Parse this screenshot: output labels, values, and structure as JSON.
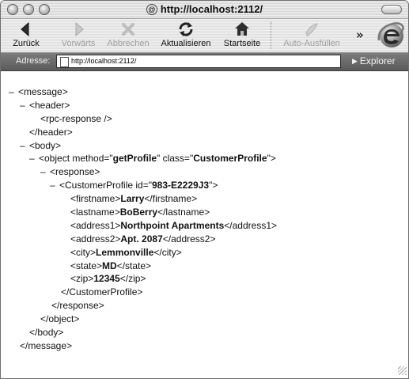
{
  "window": {
    "title": "http://localhost:2112/"
  },
  "toolbar": {
    "back_label": "Zurück",
    "forward_label": "Vorwärts",
    "stop_label": "Abbrechen",
    "refresh_label": "Aktualisieren",
    "home_label": "Startseite",
    "autofill_label": "Auto-Ausfüllen",
    "more_symbol": "»"
  },
  "address_bar": {
    "label": "Adresse:",
    "url": "http://localhost:2112/",
    "explorer_label": "Explorer"
  },
  "xml": {
    "l1": "<message>",
    "l2": "<header>",
    "l3": "<rpc-response />",
    "l4": "</header>",
    "l5": "<body>",
    "l6_open": "<object method=\"",
    "l6_method": "getProfile",
    "l6_mid": "\" class=\"",
    "l6_class": "CustomerProfile",
    "l6_close": "\">",
    "l7": "<response>",
    "l8_open": "<CustomerProfile id=\"",
    "l8_id": "983-E2229J3",
    "l8_close": "\">",
    "firstname_open": "<firstname>",
    "firstname_value": "Larry",
    "firstname_close": "</firstname>",
    "lastname_open": "<lastname>",
    "lastname_value": "BoBerry",
    "lastname_close": "</lastname>",
    "address1_open": "<address1>",
    "address1_value": "Northpoint Apartments",
    "address1_close": "</address1>",
    "address2_open": "<address2>",
    "address2_value": "Apt. 2087",
    "address2_close": "</address2>",
    "city_open": "<city>",
    "city_value": "Lemmonville",
    "city_close": "</city>",
    "state_open": "<state>",
    "state_value": "MD",
    "state_close": "</state>",
    "zip_open": "<zip>",
    "zip_value": "12345",
    "zip_close": "</zip>",
    "l16": "</CustomerProfile>",
    "l17": "</response>",
    "l18": "</object>",
    "l19": "</body>",
    "l20": "</message>",
    "toggle": "–"
  }
}
